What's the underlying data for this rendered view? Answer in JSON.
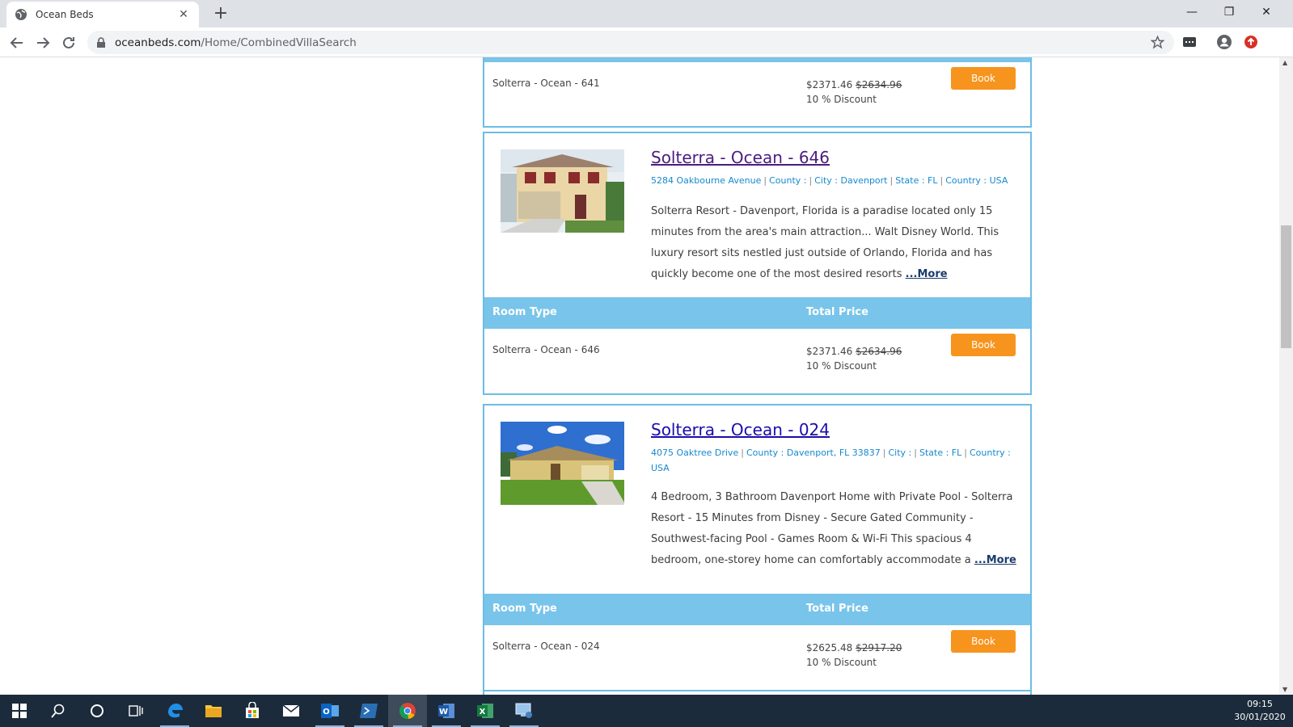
{
  "browser": {
    "tab_title": "Ocean Beds",
    "url_host": "oceanbeds.com",
    "url_path": "/Home/CombinedVillaSearch"
  },
  "listings": [
    {
      "room_type": "Solterra - Ocean - 641",
      "price": "$2371.46",
      "old_price": "$2634.96",
      "discount": "10 % Discount",
      "book_label": "Book"
    },
    {
      "title": "Solterra - Ocean - 646",
      "address": "5284 Oakbourne Avenue",
      "county": "County :",
      "city": "City : Davenport",
      "state": "State : FL",
      "country": "Country : USA",
      "description": "Solterra Resort - Davenport, Florida is a paradise located only 15 minutes from the area's main attraction... Walt Disney World. This luxury resort sits nestled just outside of Orlando, Florida and has quickly become one of the most desired resorts",
      "more_label": "...More",
      "col_room_type": "Room Type",
      "col_total_price": "Total Price",
      "room_type": "Solterra - Ocean - 646",
      "price": "$2371.46",
      "old_price": "$2634.96",
      "discount": "10 % Discount",
      "book_label": "Book"
    },
    {
      "title": "Solterra - Ocean - 024",
      "address": "4075 Oaktree Drive",
      "county": "County : Davenport, FL  33837",
      "city": "City :",
      "state": "State : FL",
      "country": "Country : USA",
      "description": "4 Bedroom, 3 Bathroom Davenport Home with Private Pool - Solterra Resort - 15 Minutes from Disney - Secure Gated Community - Southwest-facing Pool - Games Room & Wi-Fi This spacious 4 bedroom, one-storey home can comfortably accommodate a",
      "more_label": "...More",
      "col_room_type": "Room Type",
      "col_total_price": "Total Price",
      "room_type": "Solterra - Ocean - 024",
      "price": "$2625.48",
      "old_price": "$2917.20",
      "discount": "10 % Discount",
      "book_label": "Book"
    }
  ],
  "taskbar": {
    "time": "09:15",
    "date": "30/01/2020",
    "apps": [
      "start-icon",
      "search-icon",
      "cortana-icon",
      "task-view-icon",
      "edge-icon",
      "file-explorer-icon",
      "store-icon",
      "mail-icon",
      "outlook-icon",
      "powershell-icon",
      "chrome-icon",
      "word-icon",
      "excel-icon",
      "remote-desktop-icon"
    ]
  },
  "colors": {
    "accent_blue": "#79c4ea",
    "book_orange": "#f7941d",
    "link_blue": "#1589cf"
  }
}
